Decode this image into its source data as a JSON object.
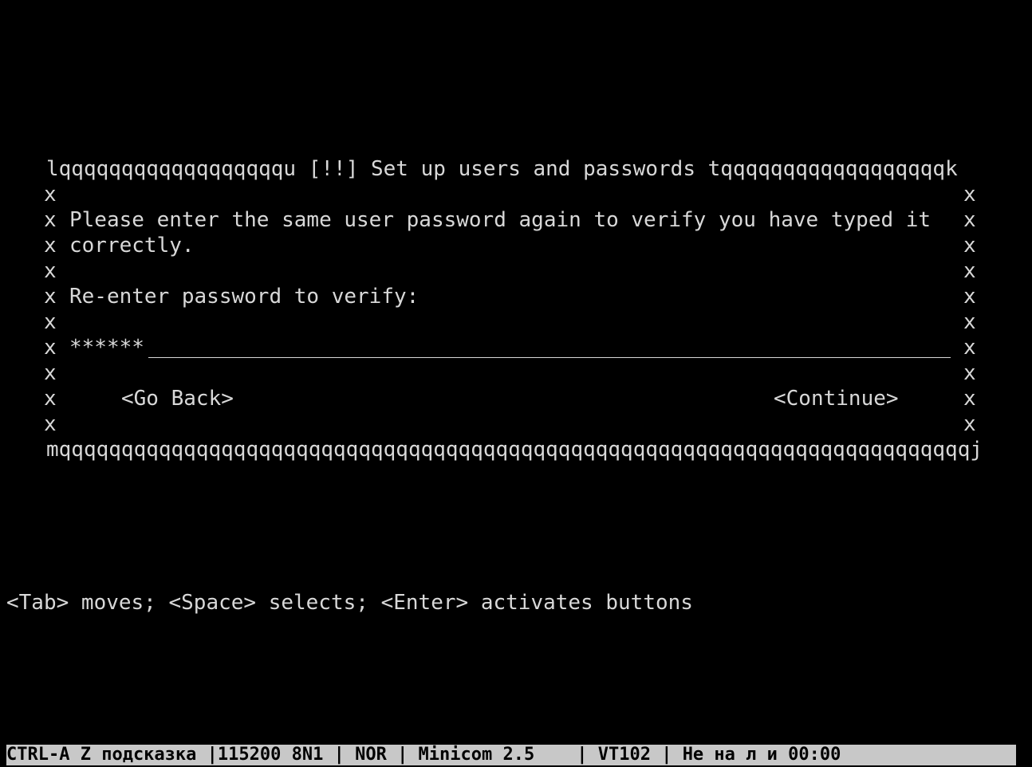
{
  "dialog": {
    "title_left_border": "lqqqqqqqqqqqqqqqqqqu",
    "title": "[!!] Set up users and passwords",
    "title_right_border": "tqqqqqqqqqqqqqqqqqqk",
    "side_char": "x",
    "message_line1": "Please enter the same user password again to verify you have typed it",
    "message_line2": "correctly.",
    "prompt": "Re-enter password to verify:",
    "password_value": "******",
    "go_back_label": "<Go Back>",
    "continue_label": "<Continue>",
    "bottom_border": "mqqqqqqqqqqqqqqqqqqqqqqqqqqqqqqqqqqqqqqqqqqqqqqqqqqqqqqqqqqqqqqqqqqqqqqqqqj"
  },
  "help_line": "<Tab> moves; <Space> selects; <Enter> activates buttons",
  "status_bar": "CTRL-A Z подсказка |115200 8N1 | NOR | Minicom 2.5    | VT102 | Не на л и 00:00"
}
